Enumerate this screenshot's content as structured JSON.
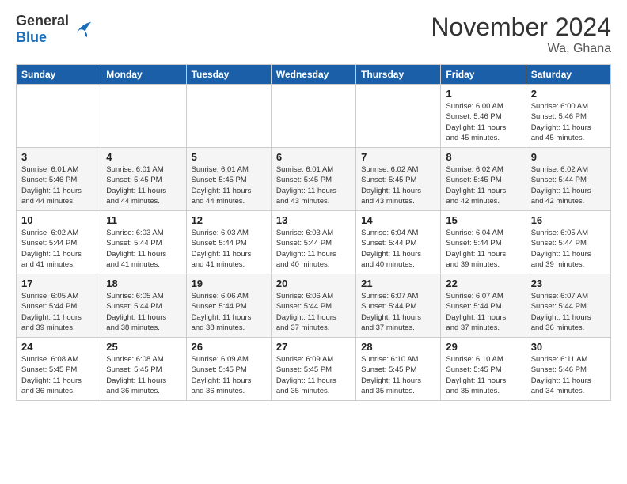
{
  "logo": {
    "general": "General",
    "blue": "Blue"
  },
  "header": {
    "month": "November 2024",
    "location": "Wa, Ghana"
  },
  "weekdays": [
    "Sunday",
    "Monday",
    "Tuesday",
    "Wednesday",
    "Thursday",
    "Friday",
    "Saturday"
  ],
  "weeks": [
    [
      {
        "day": "",
        "info": ""
      },
      {
        "day": "",
        "info": ""
      },
      {
        "day": "",
        "info": ""
      },
      {
        "day": "",
        "info": ""
      },
      {
        "day": "",
        "info": ""
      },
      {
        "day": "1",
        "info": "Sunrise: 6:00 AM\nSunset: 5:46 PM\nDaylight: 11 hours\nand 45 minutes."
      },
      {
        "day": "2",
        "info": "Sunrise: 6:00 AM\nSunset: 5:46 PM\nDaylight: 11 hours\nand 45 minutes."
      }
    ],
    [
      {
        "day": "3",
        "info": "Sunrise: 6:01 AM\nSunset: 5:46 PM\nDaylight: 11 hours\nand 44 minutes."
      },
      {
        "day": "4",
        "info": "Sunrise: 6:01 AM\nSunset: 5:45 PM\nDaylight: 11 hours\nand 44 minutes."
      },
      {
        "day": "5",
        "info": "Sunrise: 6:01 AM\nSunset: 5:45 PM\nDaylight: 11 hours\nand 44 minutes."
      },
      {
        "day": "6",
        "info": "Sunrise: 6:01 AM\nSunset: 5:45 PM\nDaylight: 11 hours\nand 43 minutes."
      },
      {
        "day": "7",
        "info": "Sunrise: 6:02 AM\nSunset: 5:45 PM\nDaylight: 11 hours\nand 43 minutes."
      },
      {
        "day": "8",
        "info": "Sunrise: 6:02 AM\nSunset: 5:45 PM\nDaylight: 11 hours\nand 42 minutes."
      },
      {
        "day": "9",
        "info": "Sunrise: 6:02 AM\nSunset: 5:44 PM\nDaylight: 11 hours\nand 42 minutes."
      }
    ],
    [
      {
        "day": "10",
        "info": "Sunrise: 6:02 AM\nSunset: 5:44 PM\nDaylight: 11 hours\nand 41 minutes."
      },
      {
        "day": "11",
        "info": "Sunrise: 6:03 AM\nSunset: 5:44 PM\nDaylight: 11 hours\nand 41 minutes."
      },
      {
        "day": "12",
        "info": "Sunrise: 6:03 AM\nSunset: 5:44 PM\nDaylight: 11 hours\nand 41 minutes."
      },
      {
        "day": "13",
        "info": "Sunrise: 6:03 AM\nSunset: 5:44 PM\nDaylight: 11 hours\nand 40 minutes."
      },
      {
        "day": "14",
        "info": "Sunrise: 6:04 AM\nSunset: 5:44 PM\nDaylight: 11 hours\nand 40 minutes."
      },
      {
        "day": "15",
        "info": "Sunrise: 6:04 AM\nSunset: 5:44 PM\nDaylight: 11 hours\nand 39 minutes."
      },
      {
        "day": "16",
        "info": "Sunrise: 6:05 AM\nSunset: 5:44 PM\nDaylight: 11 hours\nand 39 minutes."
      }
    ],
    [
      {
        "day": "17",
        "info": "Sunrise: 6:05 AM\nSunset: 5:44 PM\nDaylight: 11 hours\nand 39 minutes."
      },
      {
        "day": "18",
        "info": "Sunrise: 6:05 AM\nSunset: 5:44 PM\nDaylight: 11 hours\nand 38 minutes."
      },
      {
        "day": "19",
        "info": "Sunrise: 6:06 AM\nSunset: 5:44 PM\nDaylight: 11 hours\nand 38 minutes."
      },
      {
        "day": "20",
        "info": "Sunrise: 6:06 AM\nSunset: 5:44 PM\nDaylight: 11 hours\nand 37 minutes."
      },
      {
        "day": "21",
        "info": "Sunrise: 6:07 AM\nSunset: 5:44 PM\nDaylight: 11 hours\nand 37 minutes."
      },
      {
        "day": "22",
        "info": "Sunrise: 6:07 AM\nSunset: 5:44 PM\nDaylight: 11 hours\nand 37 minutes."
      },
      {
        "day": "23",
        "info": "Sunrise: 6:07 AM\nSunset: 5:44 PM\nDaylight: 11 hours\nand 36 minutes."
      }
    ],
    [
      {
        "day": "24",
        "info": "Sunrise: 6:08 AM\nSunset: 5:45 PM\nDaylight: 11 hours\nand 36 minutes."
      },
      {
        "day": "25",
        "info": "Sunrise: 6:08 AM\nSunset: 5:45 PM\nDaylight: 11 hours\nand 36 minutes."
      },
      {
        "day": "26",
        "info": "Sunrise: 6:09 AM\nSunset: 5:45 PM\nDaylight: 11 hours\nand 36 minutes."
      },
      {
        "day": "27",
        "info": "Sunrise: 6:09 AM\nSunset: 5:45 PM\nDaylight: 11 hours\nand 35 minutes."
      },
      {
        "day": "28",
        "info": "Sunrise: 6:10 AM\nSunset: 5:45 PM\nDaylight: 11 hours\nand 35 minutes."
      },
      {
        "day": "29",
        "info": "Sunrise: 6:10 AM\nSunset: 5:45 PM\nDaylight: 11 hours\nand 35 minutes."
      },
      {
        "day": "30",
        "info": "Sunrise: 6:11 AM\nSunset: 5:46 PM\nDaylight: 11 hours\nand 34 minutes."
      }
    ]
  ]
}
